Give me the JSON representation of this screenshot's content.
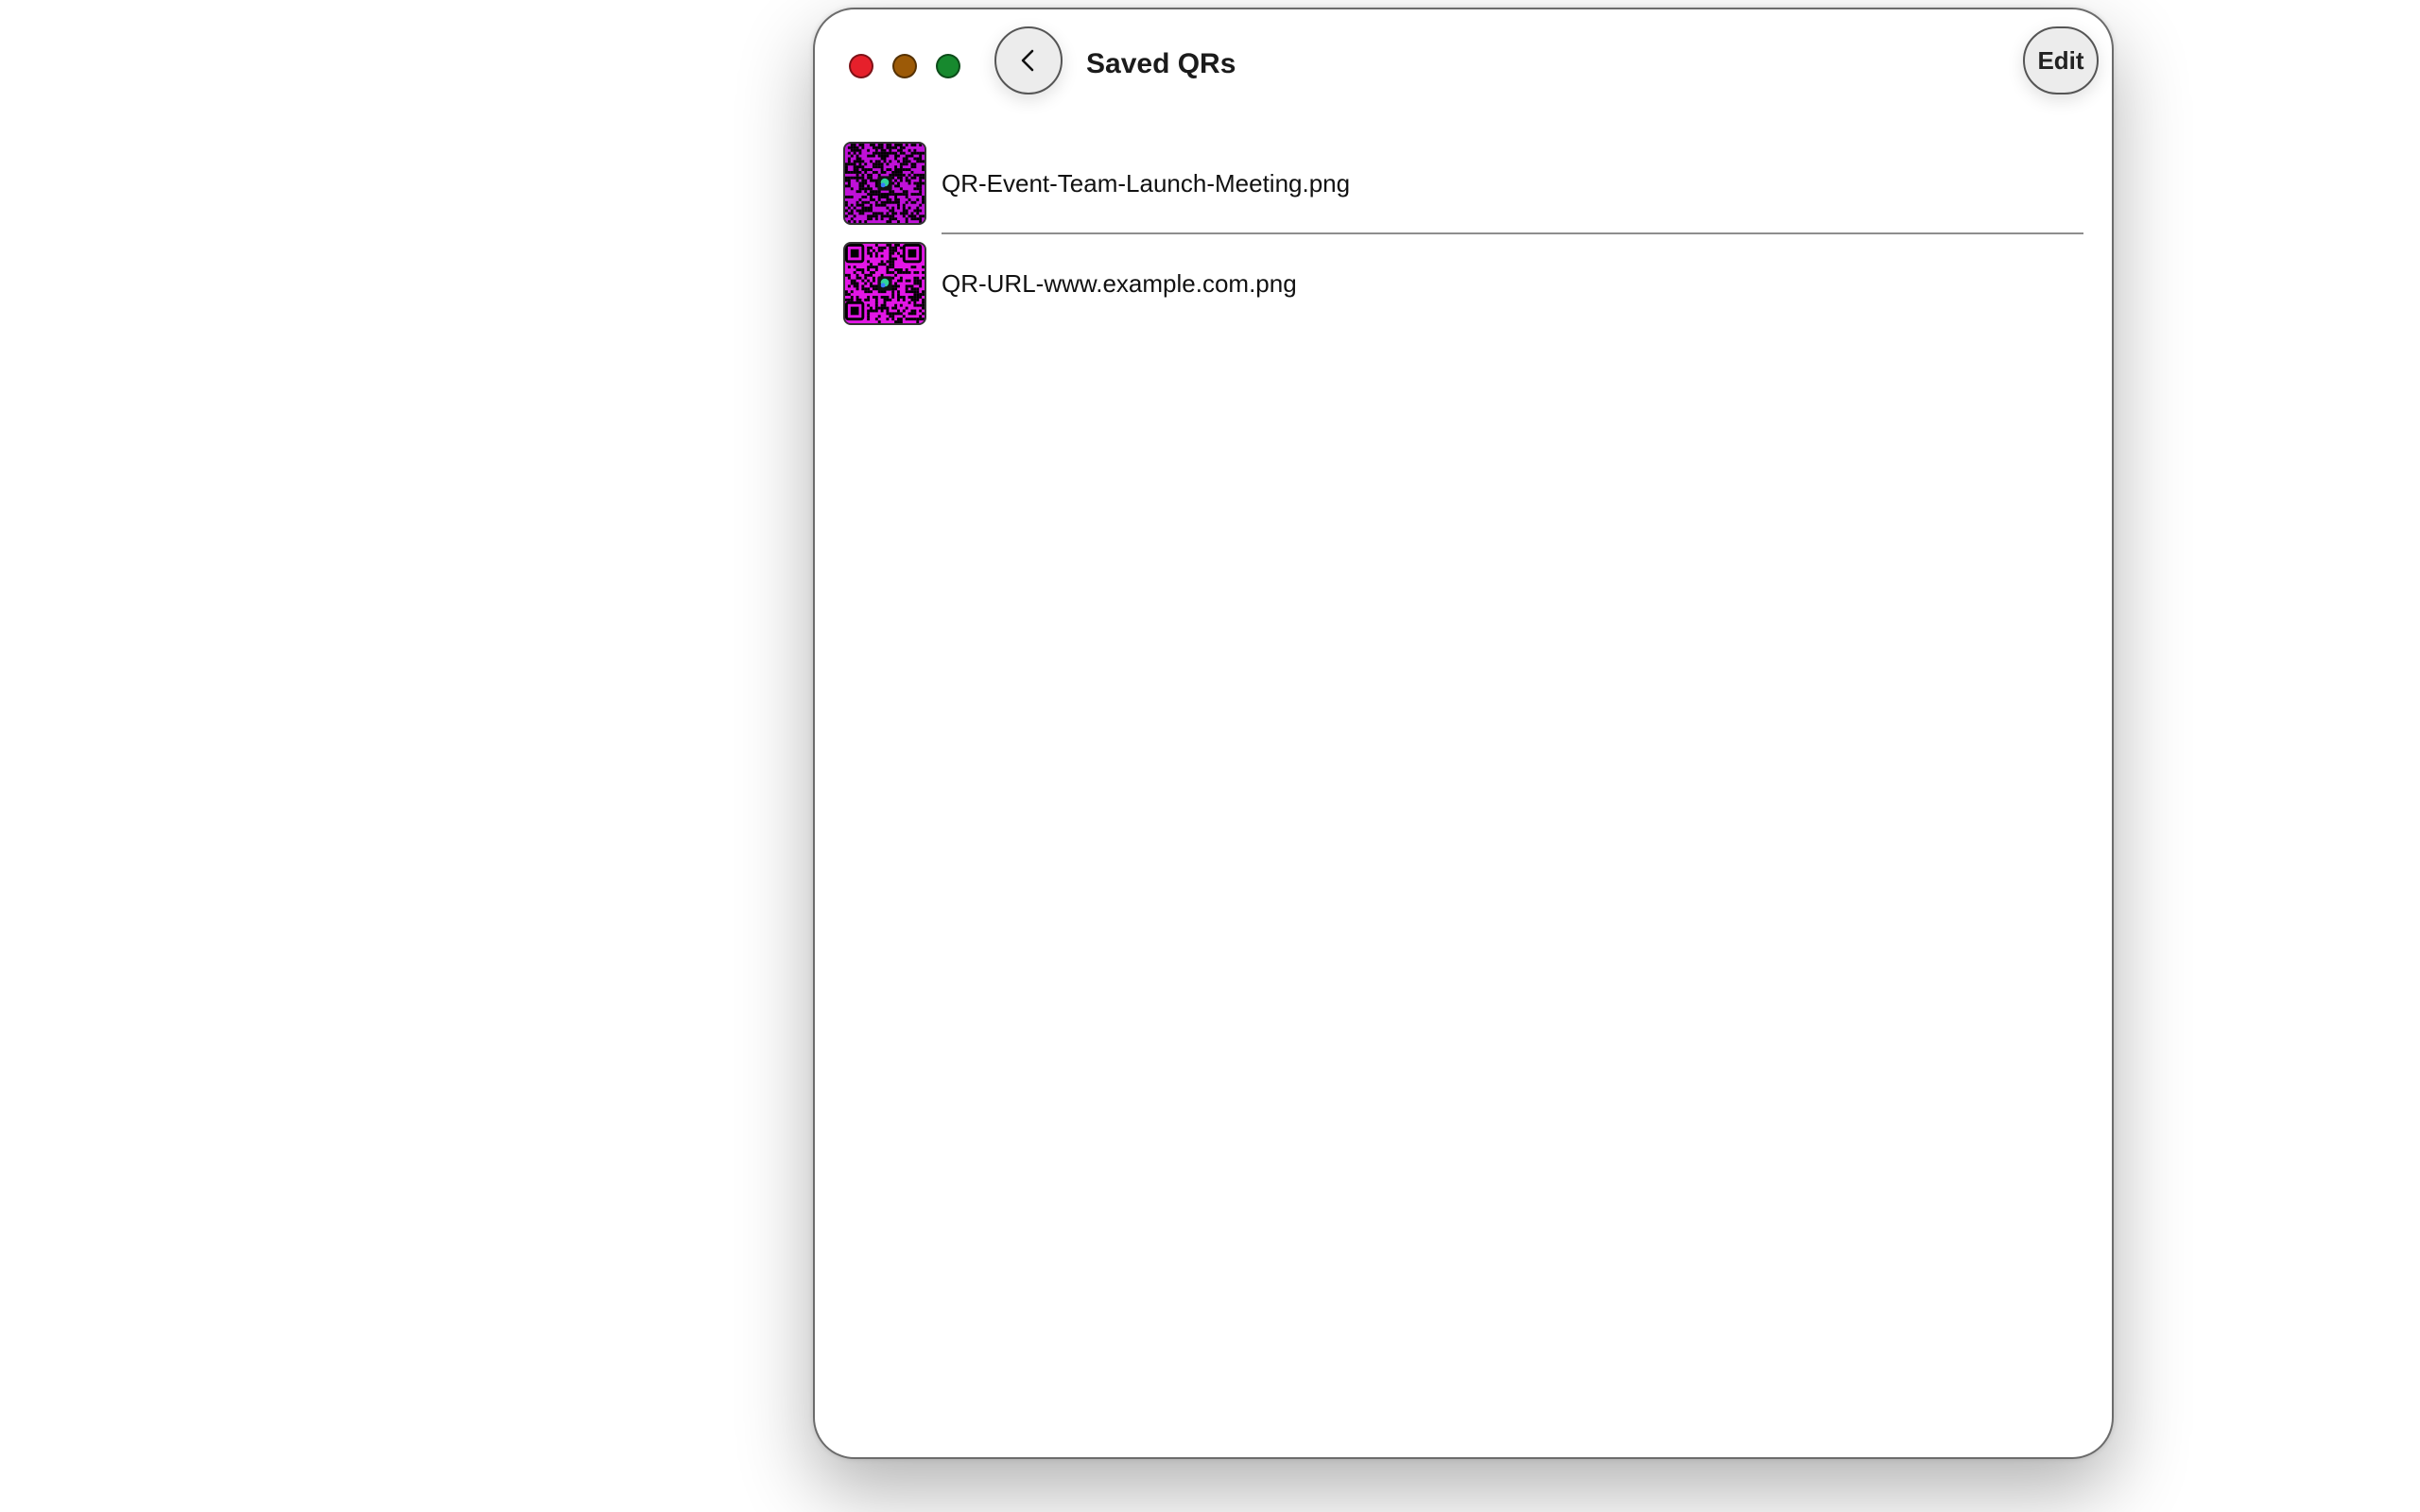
{
  "window": {
    "title": "Saved QRs",
    "edit_label": "Edit",
    "traffic_lights": {
      "close_color": "#e6202b",
      "minimize_color": "#9c5a07",
      "maximize_color": "#17892e"
    }
  },
  "icons": {
    "back": "chevron-left-icon"
  },
  "qr_list": {
    "items": [
      {
        "label": "QR-Event-Team-Launch-Meeting.png",
        "thumb_color": "#c011d8"
      },
      {
        "label": "QR-URL-www.example.com.png",
        "thumb_color": "#e316e6"
      }
    ]
  }
}
